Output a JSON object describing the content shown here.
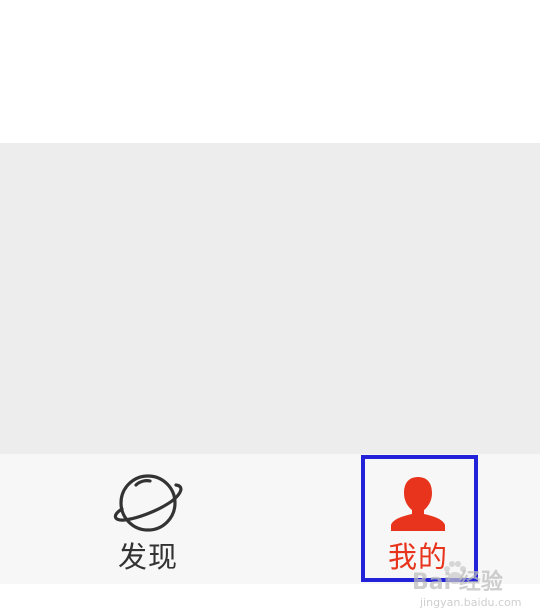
{
  "tabbar": {
    "tabs": [
      {
        "label": "发现",
        "icon": "planet-icon",
        "active": false
      },
      {
        "label": "我的",
        "icon": "person-icon",
        "active": true
      }
    ]
  },
  "colors": {
    "active": "#e8341c",
    "inactive": "#333333",
    "content_background": "#ededed",
    "highlight_box": "#2222d8"
  },
  "watermark": {
    "text": "Bai 经验",
    "url": "jingyan.baidu.com"
  }
}
